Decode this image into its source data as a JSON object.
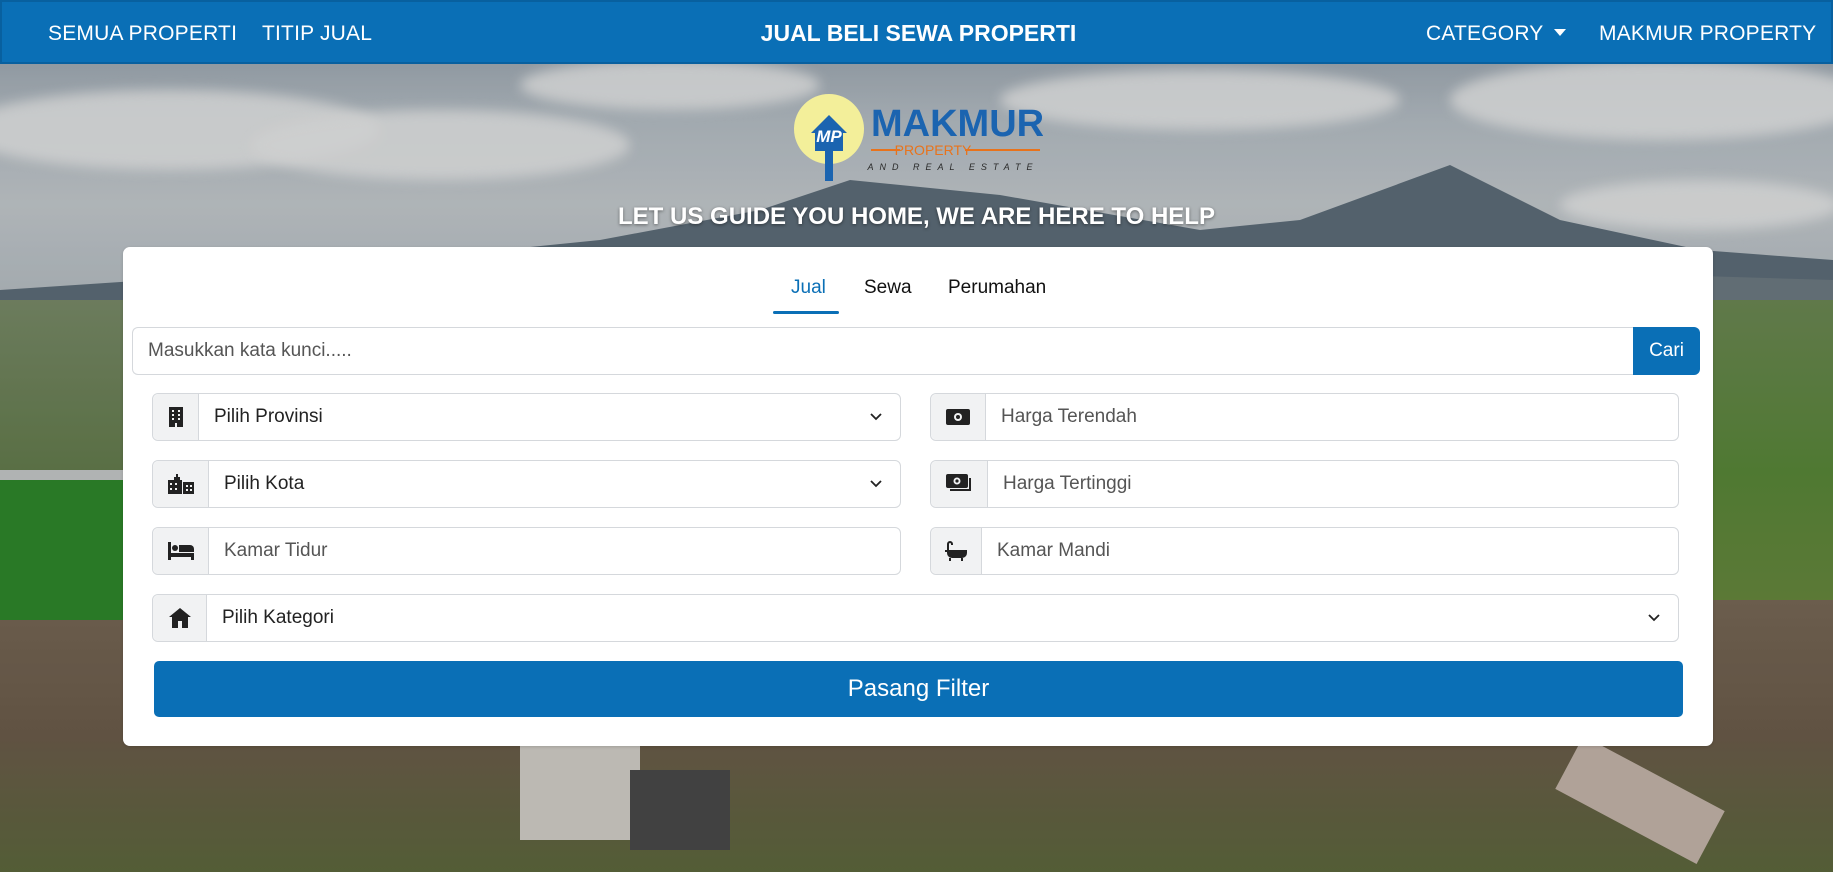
{
  "navbar": {
    "all_properties": "SEMUA PROPERTI",
    "consign": "TITIP JUAL",
    "title": "JUAL BELI SEWA PROPERTI",
    "category": "CATEGORY",
    "brand": "MAKMUR PROPERTY"
  },
  "logo": {
    "monogram": "MP",
    "name": "MAKMUR",
    "sub": "PROPERTY",
    "sub2": "AND REAL ESTATE"
  },
  "hero": {
    "tagline": "LET US GUIDE YOU HOME, WE ARE HERE TO HELP"
  },
  "tabs": [
    {
      "label": "Jual",
      "active": true
    },
    {
      "label": "Sewa",
      "active": false
    },
    {
      "label": "Perumahan",
      "active": false
    }
  ],
  "search": {
    "placeholder": "Masukkan kata kunci.....",
    "button": "Cari"
  },
  "filters": {
    "province": {
      "value": "Pilih Provinsi",
      "icon": "building-icon"
    },
    "city": {
      "value": "Pilih Kota",
      "icon": "city-icon"
    },
    "bedrooms": {
      "placeholder": "Kamar Tidur",
      "icon": "bed-icon"
    },
    "min_price": {
      "placeholder": "Harga Terendah",
      "icon": "money-bill-icon"
    },
    "max_price": {
      "placeholder": "Harga Tertinggi",
      "icon": "money-bills-icon"
    },
    "bathrooms": {
      "placeholder": "Kamar Mandi",
      "icon": "bath-icon"
    },
    "category": {
      "value": "Pilih Kategori",
      "icon": "home-icon"
    }
  },
  "submit": "Pasang Filter",
  "colors": {
    "primary": "#0a6fb6",
    "logo_blue": "#1b64b0",
    "logo_orange": "#e8731c",
    "logo_yellow": "#f3ef9a"
  }
}
